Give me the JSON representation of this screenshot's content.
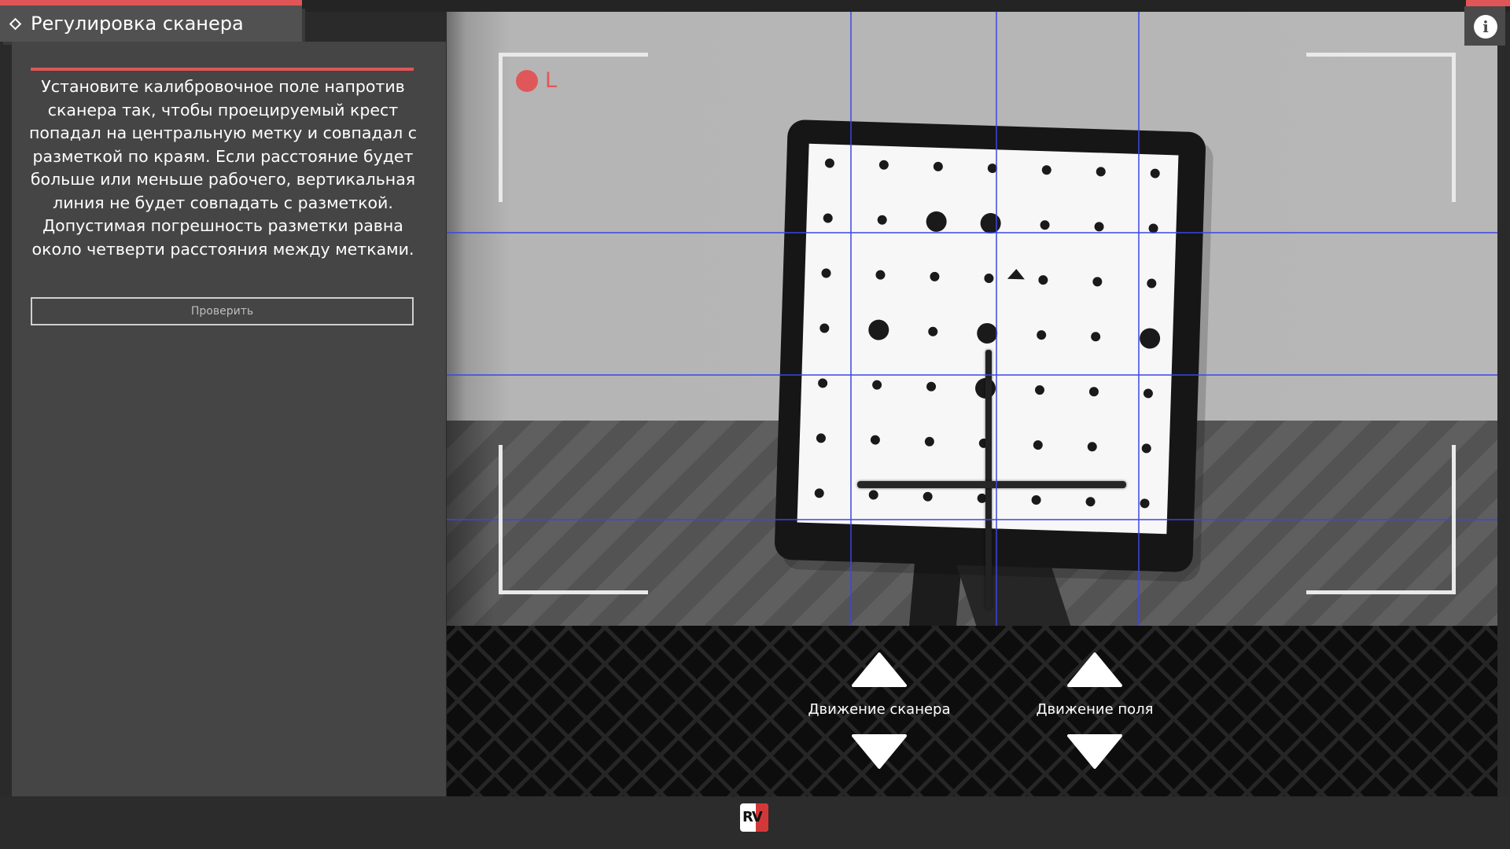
{
  "header": {
    "title": "Регулировка сканера",
    "title_icon": "diamond-icon",
    "accent_color": "#e05557"
  },
  "instructions": {
    "text": "Установите калибровочное поле напротив сканера так, чтобы проецируемый крест попадал на центральную метку и совпадал с разметкой по краям. Если расстояние будет больше или меньше рабочего, вертикальная линия не будет совпадать с разметкой. Допустимая погрешность разметки равна около четверти расстояния между метками."
  },
  "check_button": {
    "label": "Проверить"
  },
  "camera": {
    "record_indicator_label": "L",
    "record_color": "#e0575a",
    "guide_line_color": "#3c46e6"
  },
  "controls": {
    "scanner": {
      "label": "Движение сканера",
      "up_icon": "arrow-up-icon",
      "down_icon": "arrow-down-icon"
    },
    "field": {
      "label": "Движение поля",
      "up_icon": "arrow-up-icon",
      "down_icon": "arrow-down-icon"
    }
  },
  "info_button": {
    "icon": "info-icon",
    "glyph": "i"
  },
  "logo": {
    "text": "RV"
  }
}
